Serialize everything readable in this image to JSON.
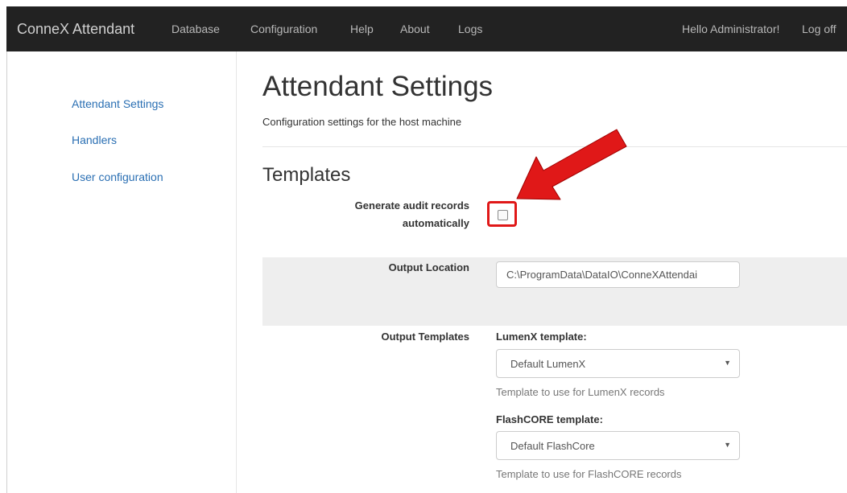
{
  "navbar": {
    "brand": "ConneX Attendant",
    "items": [
      "Database",
      "Configuration",
      "Help",
      "About",
      "Logs"
    ],
    "greeting": "Hello Administrator!",
    "logoff": "Log off"
  },
  "sidebar": {
    "items": [
      {
        "label": "Attendant Settings"
      },
      {
        "label": "Handlers"
      },
      {
        "label": "User configuration"
      }
    ]
  },
  "main": {
    "title": "Attendant Settings",
    "subtitle": "Configuration settings for the host machine",
    "section_title": "Templates",
    "audit": {
      "label_line1": "Generate audit records",
      "label_line2": "automatically",
      "checked": false
    },
    "output_location": {
      "label": "Output Location",
      "value": "C:\\ProgramData\\DataIO\\ConneXAttendai"
    },
    "output_templates": {
      "label": "Output Templates",
      "lumenx": {
        "label": "LumenX template:",
        "selected": "Default LumenX",
        "help": "Template to use for LumenX records"
      },
      "flashcore": {
        "label": "FlashCORE template:",
        "selected": "Default FlashCore",
        "help": "Template to use for FlashCORE records"
      }
    }
  },
  "annotation": {
    "color": "#e01818"
  }
}
